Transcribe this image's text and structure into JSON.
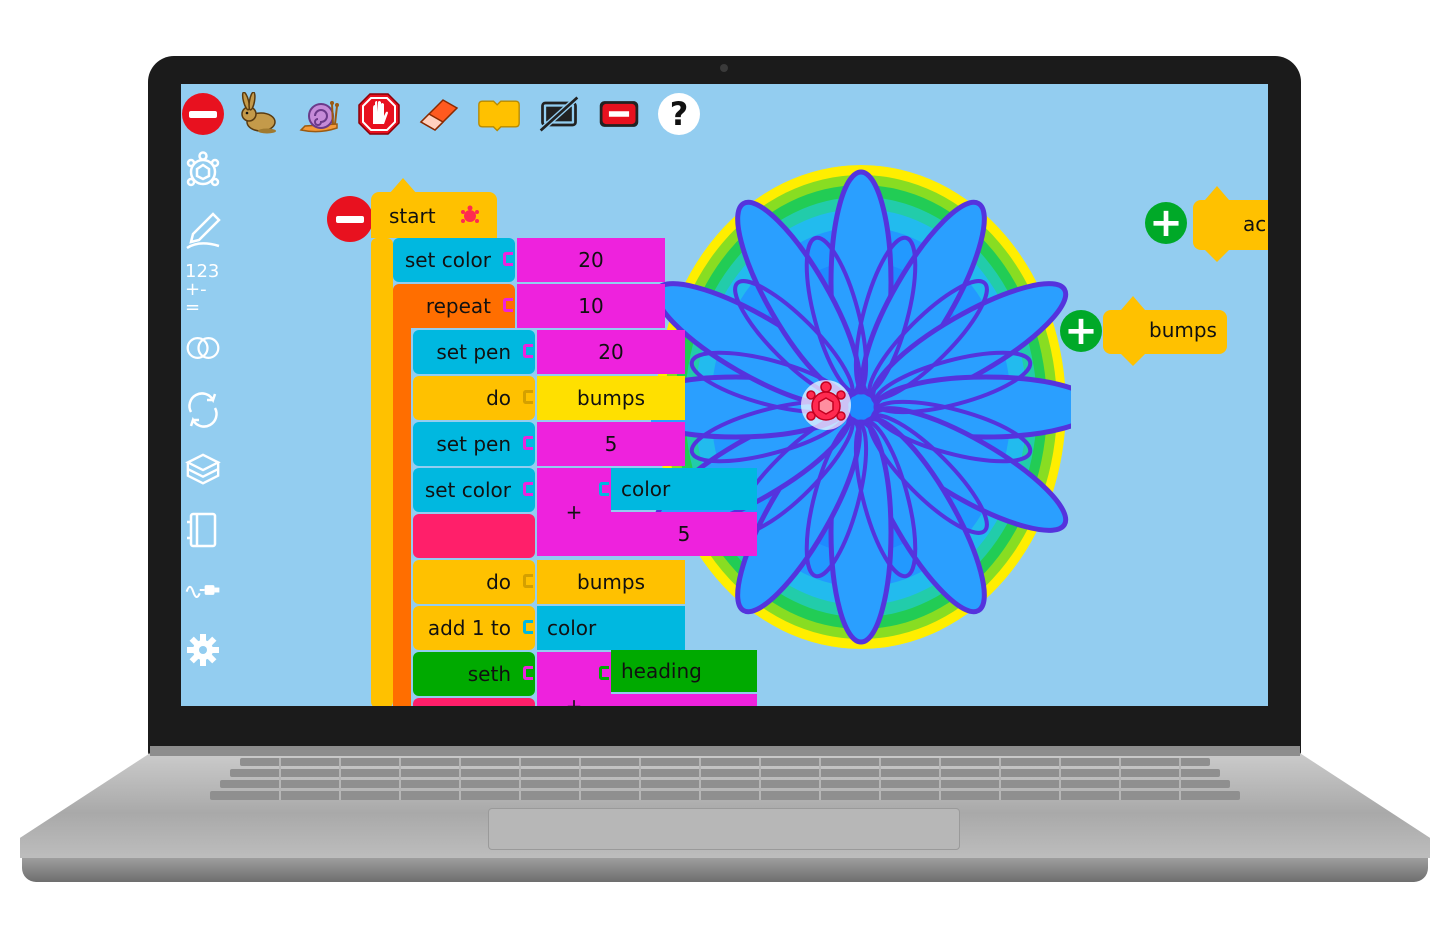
{
  "toolbar": {
    "items": [
      {
        "name": "stop-icon"
      },
      {
        "name": "rabbit-fast-run-icon"
      },
      {
        "name": "snail-slow-run-icon"
      },
      {
        "name": "hand-stop-icon"
      },
      {
        "name": "eraser-clear-icon"
      },
      {
        "name": "collapse-block-icon"
      },
      {
        "name": "hide-blocks-icon"
      },
      {
        "name": "collapse-stack-icon"
      },
      {
        "name": "help-icon"
      }
    ]
  },
  "palette": {
    "items": [
      "turtle-icon",
      "pen-icon",
      "numbers-icon",
      "boolean-icon",
      "flow-icon",
      "boxes-icon",
      "actions-icon",
      "sensors-icon",
      "settings-icon"
    ],
    "numbers_line1": "123",
    "numbers_line2": "+-="
  },
  "blocks": {
    "start": "start",
    "set_color_1": "set color",
    "set_color_1_value": "20",
    "repeat": "repeat",
    "repeat_value": "10",
    "set_pen_1": "set pen",
    "set_pen_1_value": "20",
    "do_1": "do",
    "do_1_arg": "bumps",
    "set_pen_2": "set pen",
    "set_pen_2_value": "5",
    "set_color_2": "set color",
    "plus_1": "+",
    "color_arg": "color",
    "plus_value": "5",
    "do_2": "do",
    "do_2_arg": "bumps",
    "add_1_to": "add 1 to",
    "add_arg": "color",
    "seth": "seth",
    "plus_2": "+",
    "heading_arg": "heading",
    "action_bumps": "bumps",
    "action_partial": "ac"
  },
  "colors": {
    "canvas_bg": "#93cdf0",
    "flow_orange": "#ffc100",
    "number_magenta": "#ee22dd",
    "pen_cyan": "#00b8e0"
  }
}
